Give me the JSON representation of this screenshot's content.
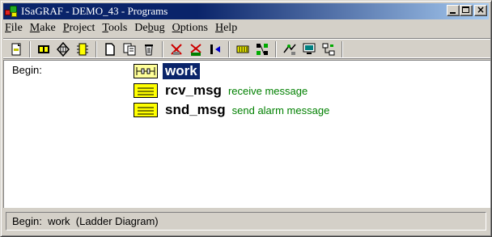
{
  "window": {
    "title": "ISaGRAF - DEMO_43 - Programs"
  },
  "menu": [
    {
      "pre": "",
      "u": "F",
      "post": "ile"
    },
    {
      "pre": "",
      "u": "M",
      "post": "ake"
    },
    {
      "pre": "",
      "u": "P",
      "post": "roject"
    },
    {
      "pre": "",
      "u": "T",
      "post": "ools"
    },
    {
      "pre": "De",
      "u": "b",
      "post": "ug"
    },
    {
      "pre": "",
      "u": "O",
      "post": "ptions"
    },
    {
      "pre": "",
      "u": "H",
      "post": "elp"
    }
  ],
  "toolbar": {
    "icons": [
      "page-edit-icon",
      "dictionary-icon",
      "connect-icon",
      "io-wiring-icon",
      "new-program-icon",
      "copy-icon",
      "delete-icon",
      "compile-icon",
      "verify-icon",
      "simulate-icon",
      "memory-icon",
      "link-icon",
      "debug-icon",
      "monitor-icon",
      "network-icon"
    ]
  },
  "content": {
    "begin_label": "Begin:",
    "programs": [
      {
        "name": "work",
        "comment": "",
        "icon": "ladder-diagram-icon",
        "selected": true
      },
      {
        "name": "rcv_msg",
        "comment": "receive message",
        "icon": "structured-text-icon",
        "selected": false
      },
      {
        "name": "snd_msg",
        "comment": "send alarm message",
        "icon": "structured-text-icon",
        "selected": false
      }
    ]
  },
  "status": {
    "text": "Begin:  work  (Ladder Diagram)"
  },
  "colors": {
    "title_bar": "#0a246a",
    "comment": "#008000",
    "selection": "#0a246a"
  }
}
